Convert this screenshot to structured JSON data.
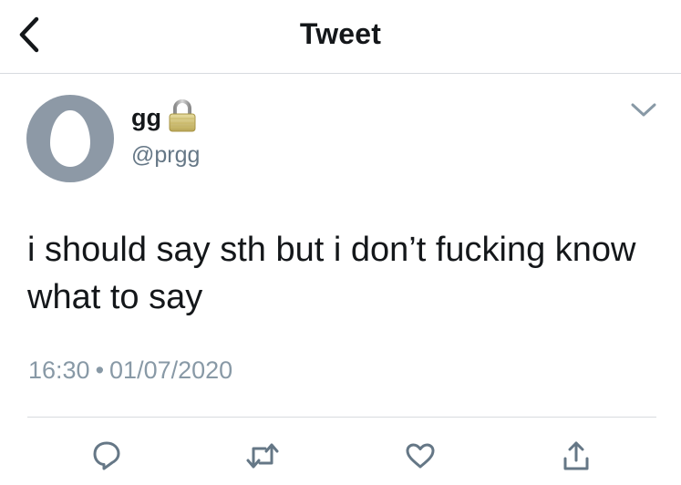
{
  "header": {
    "title": "Tweet",
    "back_icon": "chevron-left-icon"
  },
  "tweet": {
    "author": {
      "name": "gg",
      "handle": "@prgg",
      "protected_icon": "lock-icon",
      "avatar_icon": "default-egg-avatar"
    },
    "text": "i should say sth but i don’t fucking know what to say",
    "time": "16:30",
    "separator": "•",
    "date": "01/07/2020",
    "menu_icon": "chevron-down-icon"
  },
  "actions": [
    {
      "name": "reply",
      "icon": "reply-icon"
    },
    {
      "name": "retweet",
      "icon": "retweet-icon"
    },
    {
      "name": "like",
      "icon": "heart-icon"
    },
    {
      "name": "share",
      "icon": "share-icon"
    }
  ],
  "colors": {
    "text": "#14171a",
    "secondary": "#657786",
    "meta": "#8899a6",
    "divider": "#d7dbdf",
    "icon": "#657786",
    "avatar_bg": "#8d99a6"
  }
}
